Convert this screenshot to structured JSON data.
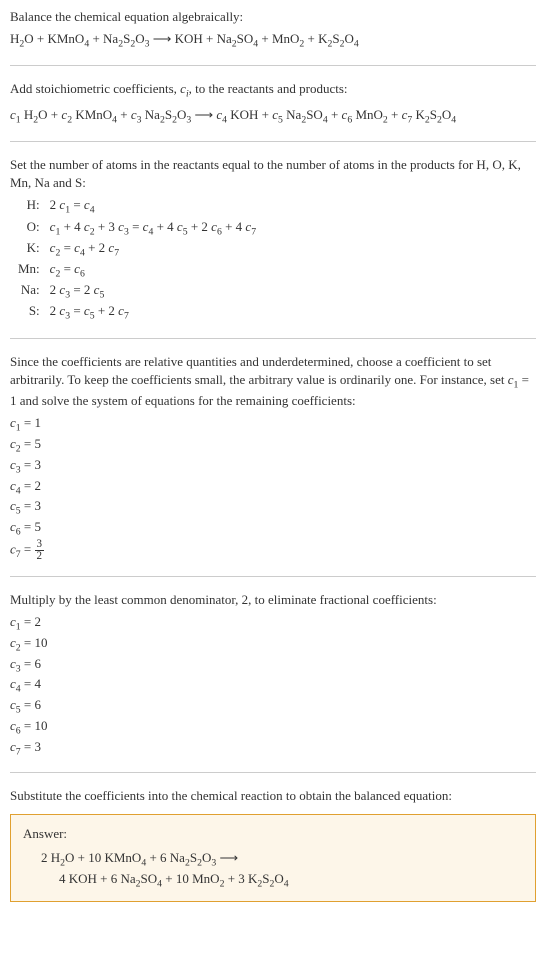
{
  "chart_data": {
    "type": "table",
    "title": "Chemical equation balancing via algebraic method",
    "reaction": {
      "reactants": [
        "H2O",
        "KMnO4",
        "Na2S2O3"
      ],
      "products": [
        "KOH",
        "Na2SO4",
        "MnO2",
        "K2S2O4"
      ]
    },
    "atom_balance": [
      {
        "element": "H",
        "equation": "2 c1 = c4"
      },
      {
        "element": "O",
        "equation": "c1 + 4 c2 + 3 c3 = c4 + 4 c5 + 2 c6 + 4 c7"
      },
      {
        "element": "K",
        "equation": "c2 = c4 + 2 c7"
      },
      {
        "element": "Mn",
        "equation": "c2 = c6"
      },
      {
        "element": "Na",
        "equation": "2 c3 = 2 c5"
      },
      {
        "element": "S",
        "equation": "2 c3 = c5 + 2 c7"
      }
    ],
    "solution_c1_1": {
      "c1": 1,
      "c2": 5,
      "c3": 3,
      "c4": 2,
      "c5": 3,
      "c6": 5,
      "c7": "3/2"
    },
    "solution_lcm_2": {
      "c1": 2,
      "c2": 10,
      "c3": 6,
      "c4": 4,
      "c5": 6,
      "c6": 10,
      "c7": 3
    },
    "balanced_equation": "2 H2O + 10 KMnO4 + 6 Na2S2O3 -> 4 KOH + 6 Na2SO4 + 10 MnO2 + 3 K2S2O4"
  },
  "s1": {
    "intro": "Balance the chemical equation algebraically:"
  },
  "s2": {
    "intro_a": "Add stoichiometric coefficients, ",
    "intro_b": ", to the reactants and products:"
  },
  "s3": {
    "intro": "Set the number of atoms in the reactants equal to the number of atoms in the products for H, O, K, Mn, Na and S:",
    "rows": [
      {
        "el": "H:",
        "eq_a": "2 ",
        "eq_b": " = "
      },
      {
        "el": "O:",
        "eq_pre": "",
        "eq_mid1": " + 4 ",
        "eq_mid2": " + 3 ",
        "eq_mid3": " = ",
        "eq_mid4": " + 4 ",
        "eq_mid5": " + 2 ",
        "eq_mid6": " + 4 "
      },
      {
        "el": "K:",
        "eq_a": "",
        "eq_b": " = ",
        "eq_c": " + 2 "
      },
      {
        "el": "Mn:",
        "eq_a": "",
        "eq_b": " = "
      },
      {
        "el": "Na:",
        "eq_a": "2 ",
        "eq_b": " = 2 "
      },
      {
        "el": "S:",
        "eq_a": "2 ",
        "eq_b": " = ",
        "eq_c": " + 2 "
      }
    ]
  },
  "s4": {
    "intro_a": "Since the coefficients are relative quantities and underdetermined, choose a coefficient to set arbitrarily. To keep the coefficients small, the arbitrary value is ordinarily one. For instance, set ",
    "intro_b": " = 1 and solve the system of equations for the remaining coefficients:",
    "coefs": [
      {
        "name": "c",
        "sub": "1",
        "val": " = 1"
      },
      {
        "name": "c",
        "sub": "2",
        "val": " = 5"
      },
      {
        "name": "c",
        "sub": "3",
        "val": " = 3"
      },
      {
        "name": "c",
        "sub": "4",
        "val": " = 2"
      },
      {
        "name": "c",
        "sub": "5",
        "val": " = 3"
      },
      {
        "name": "c",
        "sub": "6",
        "val": " = 5"
      },
      {
        "name": "c",
        "sub": "7",
        "val_prefix": " = ",
        "frac_num": "3",
        "frac_den": "2"
      }
    ]
  },
  "s5": {
    "intro": "Multiply by the least common denominator, 2, to eliminate fractional coefficients:",
    "coefs": [
      {
        "name": "c",
        "sub": "1",
        "val": " = 2"
      },
      {
        "name": "c",
        "sub": "2",
        "val": " = 10"
      },
      {
        "name": "c",
        "sub": "3",
        "val": " = 6"
      },
      {
        "name": "c",
        "sub": "4",
        "val": " = 4"
      },
      {
        "name": "c",
        "sub": "5",
        "val": " = 6"
      },
      {
        "name": "c",
        "sub": "6",
        "val": " = 10"
      },
      {
        "name": "c",
        "sub": "7",
        "val": " = 3"
      }
    ]
  },
  "s6": {
    "intro": "Substitute the coefficients into the chemical reaction to obtain the balanced equation:"
  },
  "answer": {
    "label": "Answer:",
    "line1_a": "2 H",
    "line1_b": "O + 10 KMnO",
    "line1_c": " + 6 Na",
    "line1_d": "S",
    "line1_e": "O",
    "line1_f": " ⟶",
    "line2_a": "4 KOH + 6 Na",
    "line2_b": "SO",
    "line2_c": " + 10 MnO",
    "line2_d": " + 3 K",
    "line2_e": "S",
    "line2_f": "O"
  },
  "eq1": {
    "a": "H",
    "b": "O + KMnO",
    "c": " + Na",
    "d": "S",
    "e": "O",
    "f": " ⟶ KOH + Na",
    "g": "SO",
    "h": " + MnO",
    "i": " + K",
    "j": "S",
    "k": "O"
  },
  "eq2": {
    "a": " H",
    "b": "O + ",
    "c": " KMnO",
    "d": " + ",
    "e": " Na",
    "f": "S",
    "g": "O",
    "h": " ⟶ ",
    "i": " KOH + ",
    "j": " Na",
    "k": "SO",
    "l": " + ",
    "m": " MnO",
    "n": " + ",
    "o": " K",
    "p": "S",
    "q": "O"
  },
  "ci": "c",
  "sub_i": "i",
  "subs": {
    "1": "1",
    "2": "2",
    "3": "3",
    "4": "4",
    "5": "5",
    "6": "6",
    "7": "7"
  }
}
